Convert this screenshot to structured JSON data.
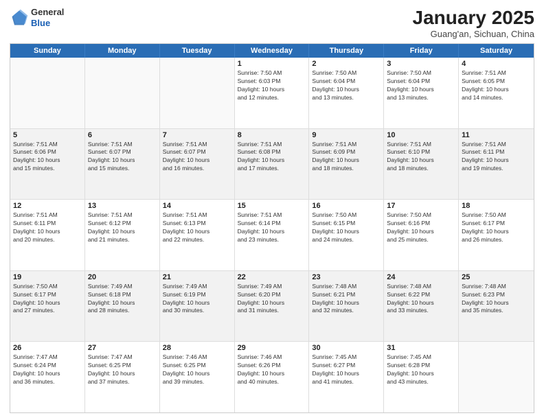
{
  "header": {
    "logo": {
      "general": "General",
      "blue": "Blue"
    },
    "title": "January 2025",
    "subtitle": "Guang'an, Sichuan, China"
  },
  "dayHeaders": [
    "Sunday",
    "Monday",
    "Tuesday",
    "Wednesday",
    "Thursday",
    "Friday",
    "Saturday"
  ],
  "weeks": [
    {
      "shaded": false,
      "days": [
        {
          "num": "",
          "info": "",
          "empty": true
        },
        {
          "num": "",
          "info": "",
          "empty": true
        },
        {
          "num": "",
          "info": "",
          "empty": true
        },
        {
          "num": "1",
          "info": "Sunrise: 7:50 AM\nSunset: 6:03 PM\nDaylight: 10 hours\nand 12 minutes.",
          "empty": false
        },
        {
          "num": "2",
          "info": "Sunrise: 7:50 AM\nSunset: 6:04 PM\nDaylight: 10 hours\nand 13 minutes.",
          "empty": false
        },
        {
          "num": "3",
          "info": "Sunrise: 7:50 AM\nSunset: 6:04 PM\nDaylight: 10 hours\nand 13 minutes.",
          "empty": false
        },
        {
          "num": "4",
          "info": "Sunrise: 7:51 AM\nSunset: 6:05 PM\nDaylight: 10 hours\nand 14 minutes.",
          "empty": false
        }
      ]
    },
    {
      "shaded": true,
      "days": [
        {
          "num": "5",
          "info": "Sunrise: 7:51 AM\nSunset: 6:06 PM\nDaylight: 10 hours\nand 15 minutes.",
          "empty": false
        },
        {
          "num": "6",
          "info": "Sunrise: 7:51 AM\nSunset: 6:07 PM\nDaylight: 10 hours\nand 15 minutes.",
          "empty": false
        },
        {
          "num": "7",
          "info": "Sunrise: 7:51 AM\nSunset: 6:07 PM\nDaylight: 10 hours\nand 16 minutes.",
          "empty": false
        },
        {
          "num": "8",
          "info": "Sunrise: 7:51 AM\nSunset: 6:08 PM\nDaylight: 10 hours\nand 17 minutes.",
          "empty": false
        },
        {
          "num": "9",
          "info": "Sunrise: 7:51 AM\nSunset: 6:09 PM\nDaylight: 10 hours\nand 18 minutes.",
          "empty": false
        },
        {
          "num": "10",
          "info": "Sunrise: 7:51 AM\nSunset: 6:10 PM\nDaylight: 10 hours\nand 18 minutes.",
          "empty": false
        },
        {
          "num": "11",
          "info": "Sunrise: 7:51 AM\nSunset: 6:11 PM\nDaylight: 10 hours\nand 19 minutes.",
          "empty": false
        }
      ]
    },
    {
      "shaded": false,
      "days": [
        {
          "num": "12",
          "info": "Sunrise: 7:51 AM\nSunset: 6:11 PM\nDaylight: 10 hours\nand 20 minutes.",
          "empty": false
        },
        {
          "num": "13",
          "info": "Sunrise: 7:51 AM\nSunset: 6:12 PM\nDaylight: 10 hours\nand 21 minutes.",
          "empty": false
        },
        {
          "num": "14",
          "info": "Sunrise: 7:51 AM\nSunset: 6:13 PM\nDaylight: 10 hours\nand 22 minutes.",
          "empty": false
        },
        {
          "num": "15",
          "info": "Sunrise: 7:51 AM\nSunset: 6:14 PM\nDaylight: 10 hours\nand 23 minutes.",
          "empty": false
        },
        {
          "num": "16",
          "info": "Sunrise: 7:50 AM\nSunset: 6:15 PM\nDaylight: 10 hours\nand 24 minutes.",
          "empty": false
        },
        {
          "num": "17",
          "info": "Sunrise: 7:50 AM\nSunset: 6:16 PM\nDaylight: 10 hours\nand 25 minutes.",
          "empty": false
        },
        {
          "num": "18",
          "info": "Sunrise: 7:50 AM\nSunset: 6:17 PM\nDaylight: 10 hours\nand 26 minutes.",
          "empty": false
        }
      ]
    },
    {
      "shaded": true,
      "days": [
        {
          "num": "19",
          "info": "Sunrise: 7:50 AM\nSunset: 6:17 PM\nDaylight: 10 hours\nand 27 minutes.",
          "empty": false
        },
        {
          "num": "20",
          "info": "Sunrise: 7:49 AM\nSunset: 6:18 PM\nDaylight: 10 hours\nand 28 minutes.",
          "empty": false
        },
        {
          "num": "21",
          "info": "Sunrise: 7:49 AM\nSunset: 6:19 PM\nDaylight: 10 hours\nand 30 minutes.",
          "empty": false
        },
        {
          "num": "22",
          "info": "Sunrise: 7:49 AM\nSunset: 6:20 PM\nDaylight: 10 hours\nand 31 minutes.",
          "empty": false
        },
        {
          "num": "23",
          "info": "Sunrise: 7:48 AM\nSunset: 6:21 PM\nDaylight: 10 hours\nand 32 minutes.",
          "empty": false
        },
        {
          "num": "24",
          "info": "Sunrise: 7:48 AM\nSunset: 6:22 PM\nDaylight: 10 hours\nand 33 minutes.",
          "empty": false
        },
        {
          "num": "25",
          "info": "Sunrise: 7:48 AM\nSunset: 6:23 PM\nDaylight: 10 hours\nand 35 minutes.",
          "empty": false
        }
      ]
    },
    {
      "shaded": false,
      "days": [
        {
          "num": "26",
          "info": "Sunrise: 7:47 AM\nSunset: 6:24 PM\nDaylight: 10 hours\nand 36 minutes.",
          "empty": false
        },
        {
          "num": "27",
          "info": "Sunrise: 7:47 AM\nSunset: 6:25 PM\nDaylight: 10 hours\nand 37 minutes.",
          "empty": false
        },
        {
          "num": "28",
          "info": "Sunrise: 7:46 AM\nSunset: 6:25 PM\nDaylight: 10 hours\nand 39 minutes.",
          "empty": false
        },
        {
          "num": "29",
          "info": "Sunrise: 7:46 AM\nSunset: 6:26 PM\nDaylight: 10 hours\nand 40 minutes.",
          "empty": false
        },
        {
          "num": "30",
          "info": "Sunrise: 7:45 AM\nSunset: 6:27 PM\nDaylight: 10 hours\nand 41 minutes.",
          "empty": false
        },
        {
          "num": "31",
          "info": "Sunrise: 7:45 AM\nSunset: 6:28 PM\nDaylight: 10 hours\nand 43 minutes.",
          "empty": false
        },
        {
          "num": "",
          "info": "",
          "empty": true
        }
      ]
    }
  ]
}
